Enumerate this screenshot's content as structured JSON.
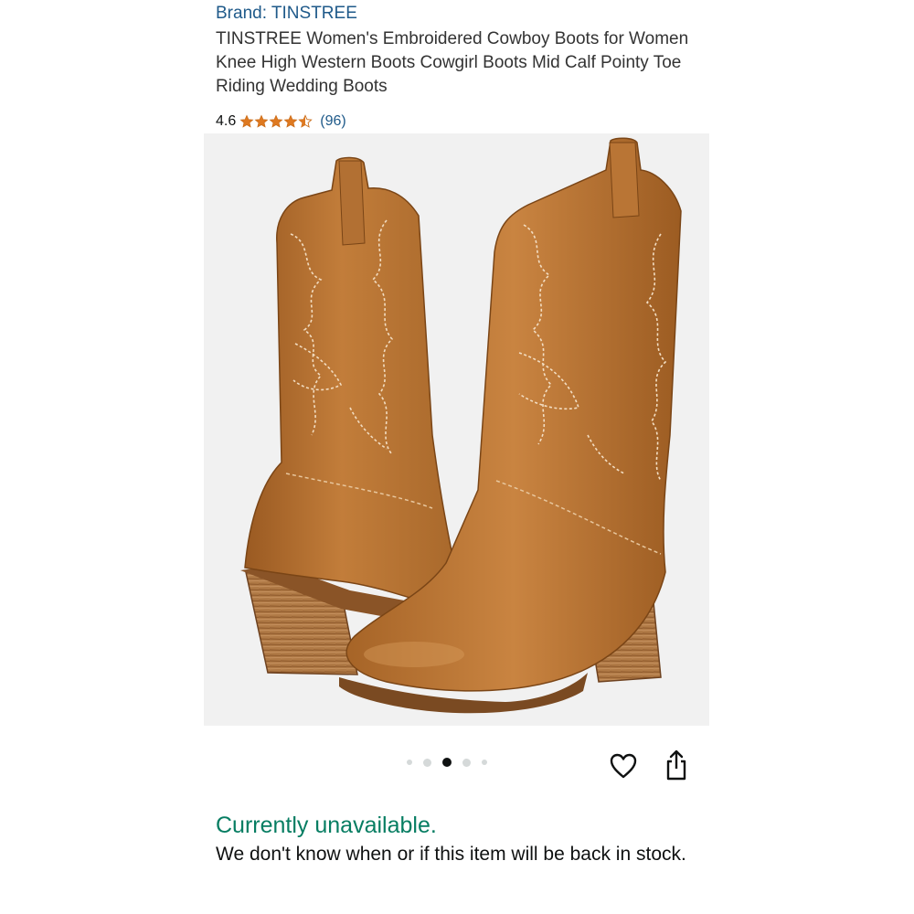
{
  "product": {
    "brand_label": "Brand: TINSTREE",
    "title": "TINSTREE Women's Embroidered Cowboy Boots for Women Knee High Western Boots Cowgirl Boots Mid Calf Pointy Toe Riding Wedding Boots",
    "rating": {
      "value": "4.6",
      "stars_filled": 4.5,
      "stars_total": 5,
      "review_count": "(96)"
    },
    "image": {
      "subject": "tan embroidered cowboy boots",
      "carousel_total": 5,
      "carousel_active_index": 2
    }
  },
  "actions": {
    "wishlist_icon": "heart-outline-icon",
    "share_icon": "share-icon"
  },
  "availability": {
    "status": "Currently unavailable.",
    "note": "We don't know when or if this item will be back in stock."
  },
  "colors": {
    "link": "#1f5a8a",
    "star": "#de7921",
    "available_green": "#067d62",
    "boot_tan": "#b8732f",
    "heel_wood": "#a9703f"
  }
}
